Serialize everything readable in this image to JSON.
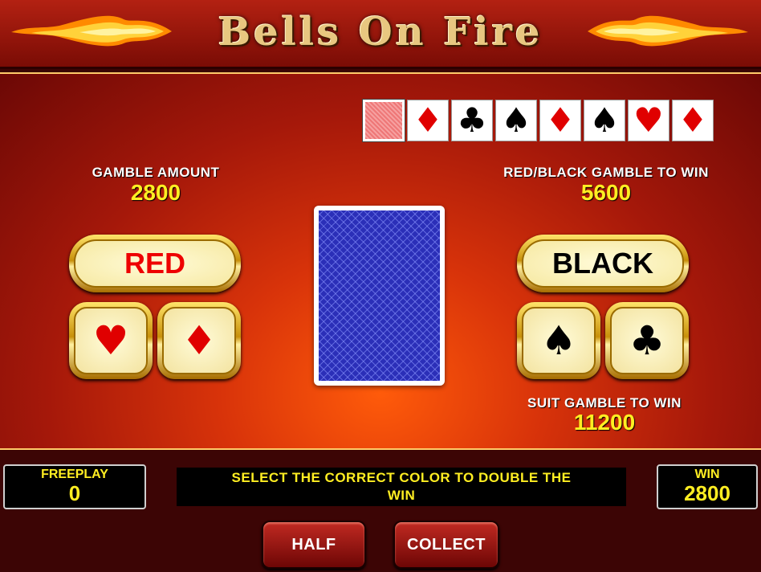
{
  "header": {
    "title": "Bells On Fire"
  },
  "history": [
    {
      "suit": "back",
      "glyph": ""
    },
    {
      "suit": "diamond",
      "glyph": "♦",
      "color": "red"
    },
    {
      "suit": "club",
      "glyph": "♣",
      "color": "black"
    },
    {
      "suit": "spade",
      "glyph": "♠",
      "color": "black"
    },
    {
      "suit": "diamond",
      "glyph": "♦",
      "color": "red"
    },
    {
      "suit": "spade",
      "glyph": "♠",
      "color": "black"
    },
    {
      "suit": "heart",
      "glyph": "♥",
      "color": "red"
    },
    {
      "suit": "diamond",
      "glyph": "♦",
      "color": "red"
    }
  ],
  "gamble": {
    "amount_label": "GAMBLE AMOUNT",
    "amount_value": "2800",
    "redblack_label": "RED/BLACK GAMBLE TO WIN",
    "redblack_value": "5600",
    "suit_label": "SUIT GAMBLE TO WIN",
    "suit_value": "11200"
  },
  "buttons": {
    "red": "RED",
    "black": "BLACK",
    "heart": "♥",
    "diamond": "♦",
    "spade": "♠",
    "club": "♣"
  },
  "footer": {
    "freeplay_label": "FREEPLAY",
    "freeplay_value": "0",
    "message": "SELECT THE CORRECT COLOR TO DOUBLE THE WIN",
    "win_label": "WIN",
    "win_value": "2800",
    "half": "HALF",
    "collect": "COLLECT"
  },
  "colors": {
    "red_accent": "#e00000",
    "gold_text": "#ffee22",
    "card_back_blue": "#2b2fb8"
  }
}
